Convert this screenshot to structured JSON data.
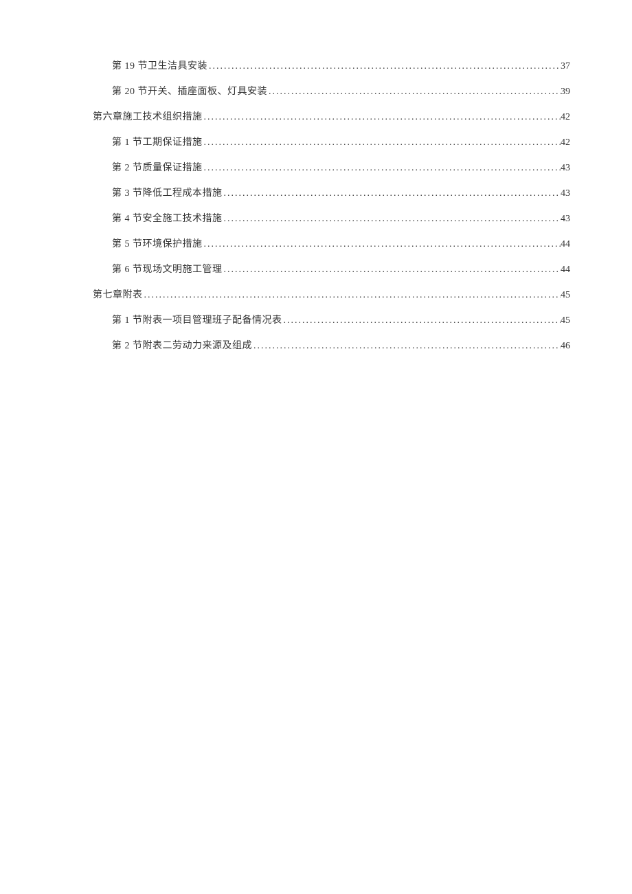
{
  "toc": [
    {
      "level": 2,
      "label": "第 19 节卫生洁具安装",
      "page": "37"
    },
    {
      "level": 2,
      "label": "第 20 节开关、插座面板、灯具安装",
      "page": "39"
    },
    {
      "level": 1,
      "label": "第六章施工技术组织措施",
      "page": "42"
    },
    {
      "level": 2,
      "label": "第 1 节工期保证措施",
      "page": "42"
    },
    {
      "level": 2,
      "label": "第 2 节质量保证措施",
      "page": "43"
    },
    {
      "level": 2,
      "label": "第 3 节降低工程成本措施",
      "page": "43"
    },
    {
      "level": 2,
      "label": "第 4 节安全施工技术措施",
      "page": "43"
    },
    {
      "level": 2,
      "label": "第 5 节环境保护措施",
      "page": "44"
    },
    {
      "level": 2,
      "label": "第 6 节现场文明施工管理",
      "page": "44"
    },
    {
      "level": 1,
      "label": "第七章附表",
      "page": "45"
    },
    {
      "level": 2,
      "label": "第 1 节附表一项目管理班子配备情况表",
      "page": "45"
    },
    {
      "level": 2,
      "label": "第 2 节附表二劳动力来源及组成",
      "page": "46"
    }
  ]
}
